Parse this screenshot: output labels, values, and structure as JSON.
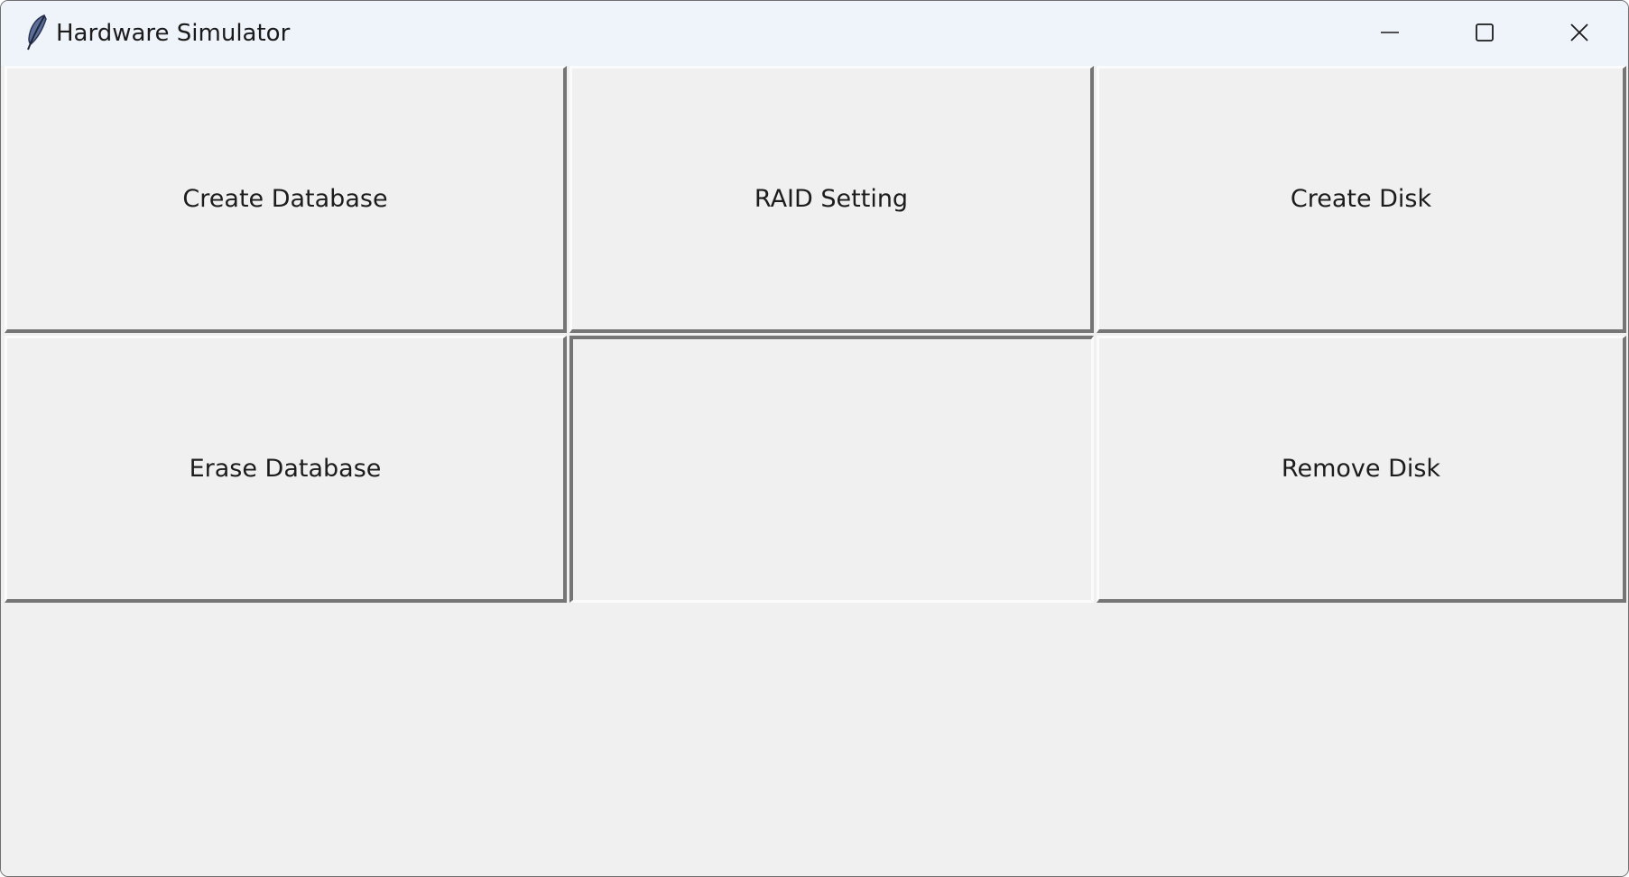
{
  "window": {
    "title": "Hardware Simulator",
    "app_icon": "feather-icon",
    "controls": {
      "minimize_icon": "minimize-icon",
      "maximize_icon": "maximize-icon",
      "close_icon": "close-icon"
    }
  },
  "buttons": {
    "create_database": "Create Database",
    "raid_setting": "RAID Setting",
    "create_disk": "Create Disk",
    "erase_database": "Erase Database",
    "middle_blank": "",
    "remove_disk": "Remove Disk"
  },
  "colors": {
    "titlebar_bg": "#eff3fa",
    "client_bg": "#f0f0f0",
    "button_highlight": "#fbfbfb",
    "button_shadow": "#757575"
  }
}
